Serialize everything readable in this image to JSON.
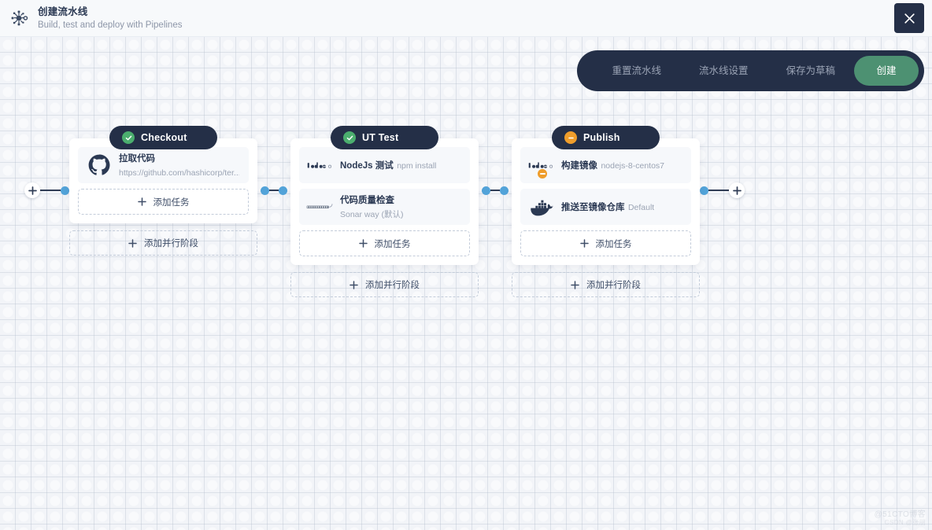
{
  "header": {
    "logo_icon": "pipeline-node-icon",
    "title": "创建流水线",
    "subtitle": "Build, test and deploy with Pipelines",
    "close_icon": "close-icon"
  },
  "toolbar": {
    "reset_label": "重置流水线",
    "settings_label": "流水线设置",
    "save_draft_label": "保存为草稿",
    "create_label": "创建",
    "accent_color": "#4d9172",
    "background_color": "#242f47"
  },
  "canvas": {
    "add_stage_start_icon": "plus-icon",
    "add_stage_end_icon": "plus-icon",
    "connector_dot_color": "#52a3d9",
    "connector_line_color": "#2f3c55"
  },
  "stages": [
    {
      "name": "Checkout",
      "status": "ok",
      "status_color": "#4bae6e",
      "status_icon": "check-circle-icon",
      "add_task_label": "添加任务",
      "add_parallel_label": "添加并行阶段",
      "tasks": [
        {
          "icon": "github-icon",
          "title": "拉取代码",
          "subtitle": "https://github.com/hashicorp/ter...",
          "badge": ""
        }
      ]
    },
    {
      "name": "UT Test",
      "status": "ok",
      "status_color": "#4bae6e",
      "status_icon": "check-circle-icon",
      "add_task_label": "添加任务",
      "add_parallel_label": "添加并行阶段",
      "tasks": [
        {
          "icon": "nodejs-icon",
          "title": "NodeJs 测试",
          "subtitle": "npm install",
          "badge": ""
        },
        {
          "icon": "sonarqube-icon",
          "title": "代码质量检查",
          "subtitle": "Sonar way (默认)",
          "badge": ""
        }
      ]
    },
    {
      "name": "Publish",
      "status": "warn",
      "status_color": "#ef9d2b",
      "status_icon": "minus-circle-icon",
      "add_task_label": "添加任务",
      "add_parallel_label": "添加并行阶段",
      "tasks": [
        {
          "icon": "nodejs-icon",
          "title": "构建镜像",
          "subtitle": "nodejs-8-centos7",
          "badge": "warn"
        },
        {
          "icon": "docker-icon",
          "title": "推送至镜像仓库",
          "subtitle": "Default",
          "badge": ""
        }
      ]
    }
  ],
  "watermark": {
    "line1": "@51CTO博客",
    "line2": "CSDN @张朋"
  }
}
